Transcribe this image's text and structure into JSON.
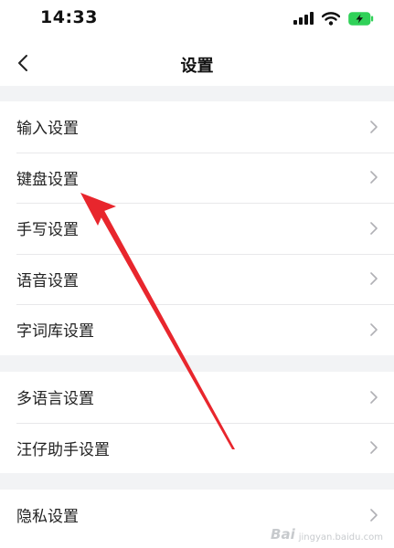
{
  "status_bar": {
    "time": "14:33",
    "icons": [
      "signal-icon",
      "wifi-icon",
      "battery-charging-icon"
    ],
    "battery_color": "#30d158"
  },
  "nav": {
    "title": "设置",
    "back_icon": "chevron-left-icon"
  },
  "groups": [
    {
      "items": [
        {
          "label": "输入设置"
        },
        {
          "label": "键盘设置"
        },
        {
          "label": "手写设置"
        },
        {
          "label": "语音设置"
        },
        {
          "label": "字词库设置"
        }
      ]
    },
    {
      "items": [
        {
          "label": "多语言设置"
        },
        {
          "label": "汪仔助手设置"
        }
      ]
    },
    {
      "items": [
        {
          "label": "隐私设置"
        }
      ]
    }
  ],
  "annotation": {
    "type": "red-arrow",
    "points_to": "键盘设置",
    "color": "#e8262d"
  },
  "watermark": {
    "logo": "Bai",
    "sub": "jingyan.baidu.com"
  }
}
